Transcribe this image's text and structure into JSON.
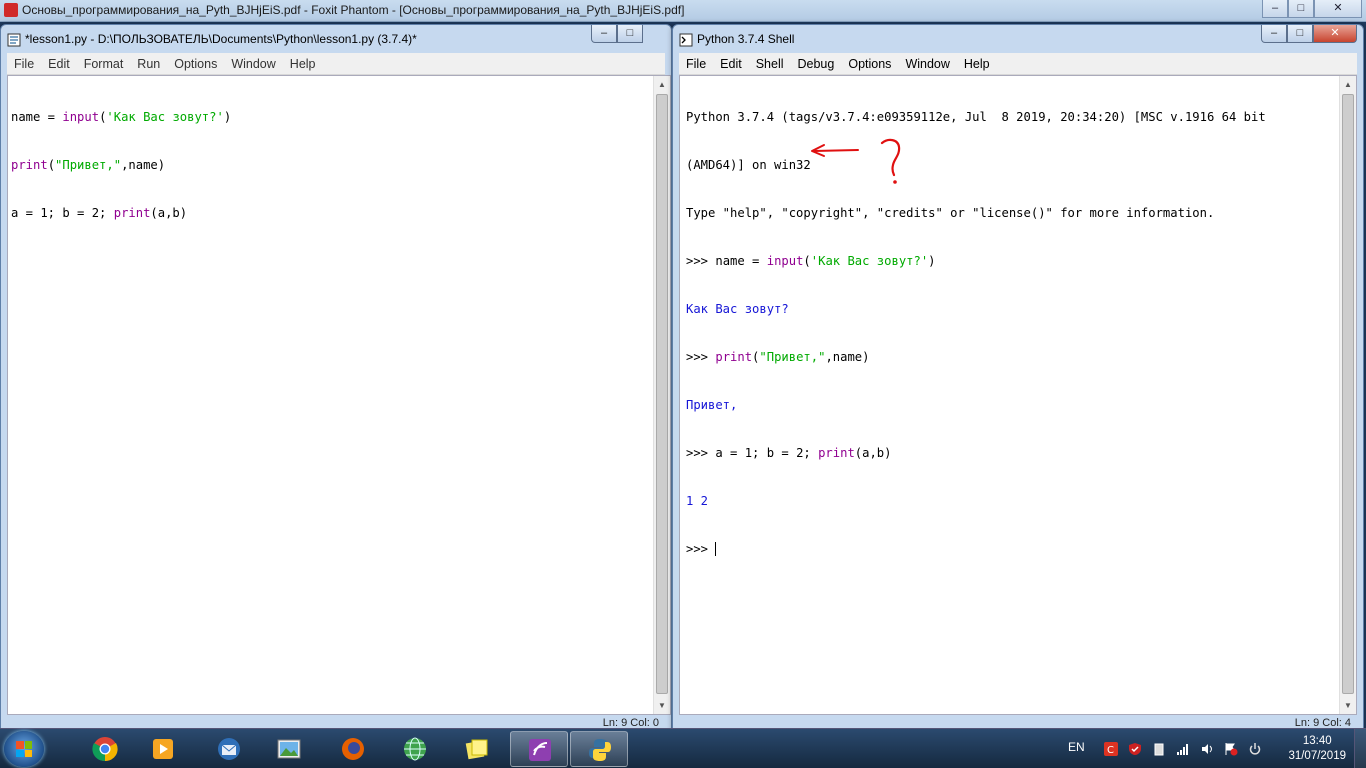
{
  "background_window": {
    "title": "Основы_программирования_на_Pyth_BJHjEiS.pdf - Foxit Phantom - [Основы_программирования_на_Pyth_BJHjEiS.pdf]",
    "controls": {
      "minimize": "–",
      "maximize": "□",
      "close": "✕"
    }
  },
  "editor": {
    "title": "*lesson1.py - D:\\ПОЛЬЗОВАТЕЛЬ\\Documents\\Python\\lesson1.py (3.7.4)*",
    "menu": [
      "File",
      "Edit",
      "Format",
      "Run",
      "Options",
      "Window",
      "Help"
    ],
    "code": {
      "line1": {
        "a": "name = ",
        "b": "input",
        "c": "(",
        "d": "'Как Вас зовут?'",
        "e": ")"
      },
      "line2": {
        "a": "print",
        "b": "(",
        "c": "\"Привет,\"",
        "d": ",name)"
      },
      "line3": {
        "a": "a = 1; b = 2; ",
        "b": "print",
        "c": "(a,b)"
      }
    },
    "status": "Ln: 9   Col: 0"
  },
  "shell": {
    "title": "Python 3.7.4 Shell",
    "menu": [
      "File",
      "Edit",
      "Shell",
      "Debug",
      "Options",
      "Window",
      "Help"
    ],
    "lines": {
      "banner1": "Python 3.7.4 (tags/v3.7.4:e09359112e, Jul  8 2019, 20:34:20) [MSC v.1916 64 bit",
      "banner2": "(AMD64)] on win32",
      "banner3": "Type \"help\", \"copyright\", \"credits\" or \"license()\" for more information.",
      "p1": {
        "prompt": ">>> ",
        "a": "name = ",
        "b": "input",
        "c": "(",
        "d": "'Как Вас зовут?'",
        "e": ")"
      },
      "out1": "Как Вас зовут?",
      "p2": {
        "prompt": ">>> ",
        "a": "print",
        "b": "(",
        "c": "\"Привет,\"",
        "d": ",name)"
      },
      "out2": "Привет,",
      "p3": {
        "prompt": ">>> ",
        "a": "a = 1; b = 2; ",
        "b": "print",
        "c": "(a,b)"
      },
      "out3": "1 2",
      "p4": {
        "prompt": ">>> "
      }
    },
    "status": "Ln: 9   Col: 4"
  },
  "taskbar": {
    "apps": [
      "chrome-icon",
      "media-player-icon",
      "thunderbird-icon",
      "image-viewer-icon",
      "firefox-icon",
      "network-globe-icon",
      "notes-icon",
      "foxit-icon",
      "python-icon"
    ],
    "tray": {
      "lang": "EN",
      "time": "13:40",
      "date": "31/07/2019"
    }
  },
  "colors": {
    "builtin": "#900090",
    "string": "#00aa00",
    "output": "#1616d6",
    "annotation": "#e01010"
  }
}
